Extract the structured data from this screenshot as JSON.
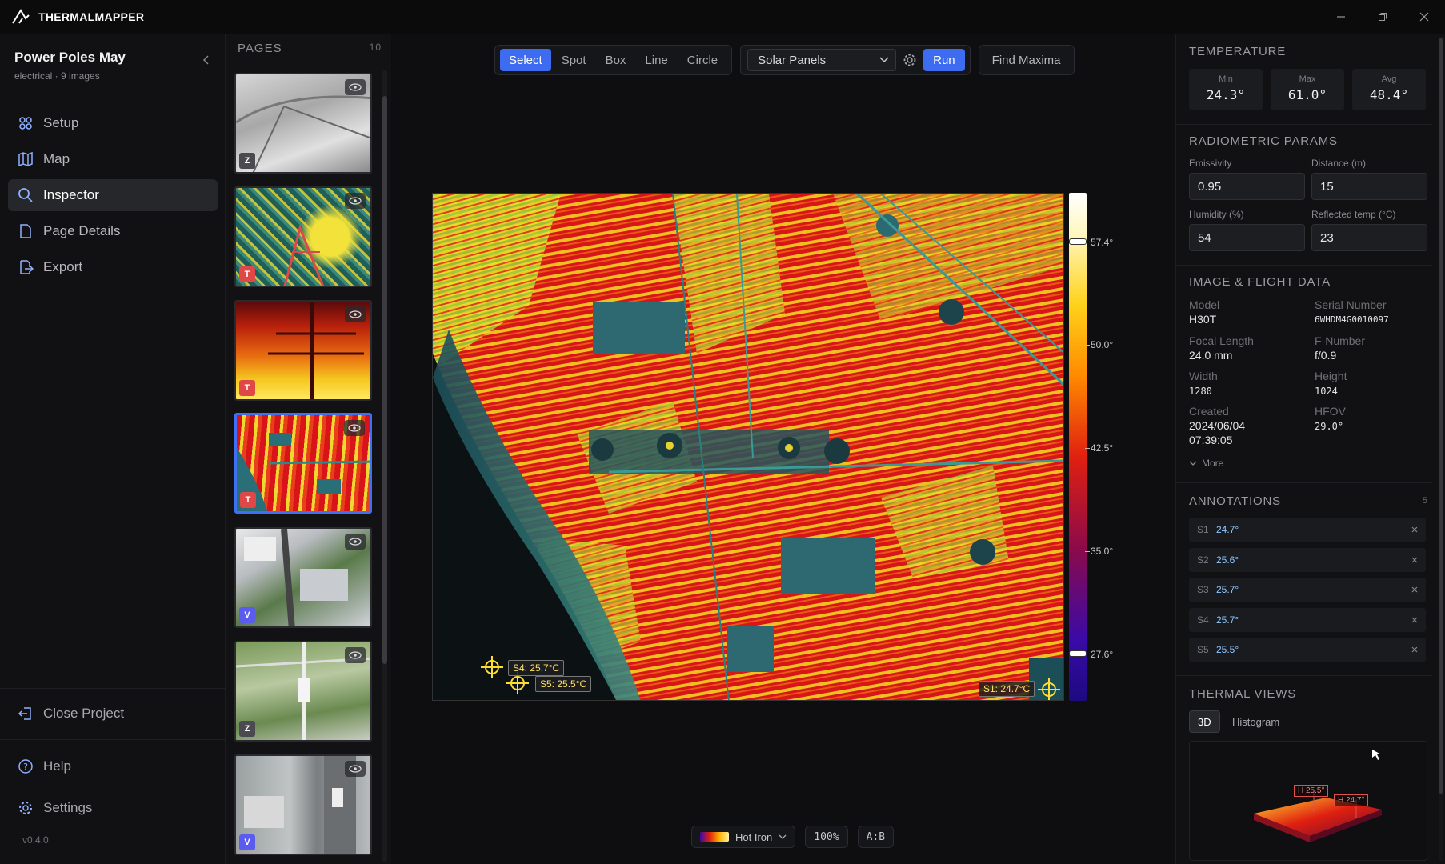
{
  "app": {
    "logo_text_bold": "THERMAL",
    "logo_text_rest": "MAPPER",
    "window_controls": [
      "minimize",
      "maximize",
      "close"
    ]
  },
  "project": {
    "name": "Power Poles May",
    "subtitle": "electrical · 9 images"
  },
  "nav": {
    "items": [
      {
        "label": "Setup",
        "icon": "setup-icon"
      },
      {
        "label": "Map",
        "icon": "map-icon"
      },
      {
        "label": "Inspector",
        "icon": "search-icon",
        "active": true
      },
      {
        "label": "Page Details",
        "icon": "document-icon"
      },
      {
        "label": "Export",
        "icon": "export-icon"
      }
    ],
    "close_project": "Close Project",
    "help": "Help",
    "settings": "Settings",
    "version": "v0.4.0"
  },
  "pages": {
    "header": "PAGES",
    "count": "10",
    "thumbs": [
      {
        "badge": "Z",
        "kind": "z"
      },
      {
        "badge": "T",
        "kind": "t"
      },
      {
        "badge": "T",
        "kind": "t"
      },
      {
        "badge": "T",
        "kind": "t",
        "selected": true
      },
      {
        "badge": "V",
        "kind": "v"
      },
      {
        "badge": "Z",
        "kind": "z"
      },
      {
        "badge": "V",
        "kind": "v"
      }
    ]
  },
  "toolbar": {
    "tools": [
      "Select",
      "Spot",
      "Box",
      "Line",
      "Circle"
    ],
    "active_tool": "Select",
    "detector": "Solar Panels",
    "run": "Run",
    "find_maxima": "Find Maxima"
  },
  "image": {
    "tags": {
      "s4": "S4: 25.7°C",
      "s5": "S5: 25.5°C",
      "s1": "S1: 24.7°C"
    },
    "scale": [
      "57.4°",
      "50.0°",
      "42.5°",
      "35.0°",
      "27.6°"
    ]
  },
  "bottom": {
    "palette": "Hot Iron",
    "zoom": "100%",
    "ab": "A:B"
  },
  "temperature": {
    "title": "TEMPERATURE",
    "min_label": "Min",
    "min": "24.3°",
    "max_label": "Max",
    "max": "61.0°",
    "avg_label": "Avg",
    "avg": "48.4°"
  },
  "radiometric": {
    "title": "RADIOMETRIC PARAMS",
    "emissivity_label": "Emissivity",
    "emissivity": "0.95",
    "distance_label": "Distance (m)",
    "distance": "15",
    "humidity_label": "Humidity (%)",
    "humidity": "54",
    "reflected_label": "Reflected temp (°C)",
    "reflected": "23"
  },
  "flight": {
    "title": "IMAGE & FLIGHT DATA",
    "model_label": "Model",
    "model": "H30T",
    "serial_label": "Serial Number",
    "serial": "6WHDM4G0010097",
    "focal_label": "Focal Length",
    "focal": "24.0 mm",
    "fnum_label": "F-Number",
    "fnum": "f/0.9",
    "width_label": "Width",
    "width": "1280",
    "height_label": "Height",
    "height": "1024",
    "created_label": "Created",
    "created_date": "2024/06/04",
    "created_time": "07:39:05",
    "hfov_label": "HFOV",
    "hfov": "29.0°",
    "more": "More"
  },
  "annotations": {
    "title": "ANNOTATIONS",
    "count": "5",
    "items": [
      {
        "id": "S1",
        "value": "24.7°"
      },
      {
        "id": "S2",
        "value": "25.6°"
      },
      {
        "id": "S3",
        "value": "25.7°"
      },
      {
        "id": "S4",
        "value": "25.7°"
      },
      {
        "id": "S5",
        "value": "25.5°"
      }
    ]
  },
  "views": {
    "title": "THERMAL VIEWS",
    "tab_3d": "3D",
    "tab_hist": "Histogram",
    "h1": "H 25.5°",
    "h2": "H 24.7°"
  }
}
